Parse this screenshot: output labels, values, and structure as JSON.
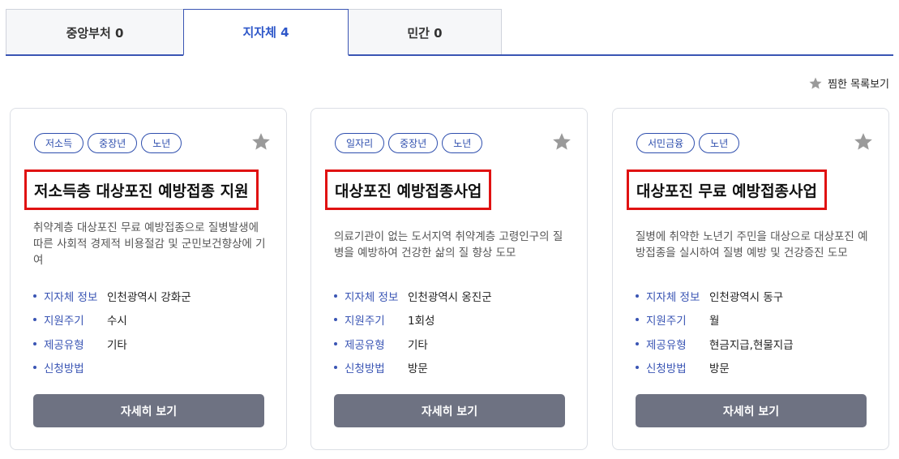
{
  "tabs": [
    {
      "label": "중앙부처 0"
    },
    {
      "label": "지자체 4"
    },
    {
      "label": "민간 0"
    }
  ],
  "favorites_link": {
    "label": "찜한 목록보기",
    "icon": "star-icon"
  },
  "colors": {
    "accent": "#2e57c9",
    "tag_border": "#2f4fae",
    "button": "#6e7282",
    "highlight": "#e01212",
    "star": "#9a9a9a"
  },
  "cards": [
    {
      "tags": [
        "저소득",
        "중장년",
        "노년"
      ],
      "title": "저소득층 대상포진 예방접종 지원",
      "desc": "취약계층 대상포진 무료 예방접종으로 질병발생에 따른 사회적 경제적 비용절감 및 군민보건향상에 기여",
      "info": [
        {
          "key": "지자체 정보",
          "value": "인천광역시 강화군"
        },
        {
          "key": "지원주기",
          "value": "수시"
        },
        {
          "key": "제공유형",
          "value": "기타"
        },
        {
          "key": "신청방법",
          "value": ""
        }
      ],
      "button": "자세히 보기"
    },
    {
      "tags": [
        "일자리",
        "중장년",
        "노년"
      ],
      "title": "대상포진 예방접종사업",
      "desc": "의료기관이 없는 도서지역 취약계층 고령인구의 질병을 예방하여 건강한 삶의 질 향상 도모",
      "info": [
        {
          "key": "지자체 정보",
          "value": "인천광역시 옹진군"
        },
        {
          "key": "지원주기",
          "value": "1회성"
        },
        {
          "key": "제공유형",
          "value": "기타"
        },
        {
          "key": "신청방법",
          "value": "방문"
        }
      ],
      "button": "자세히 보기"
    },
    {
      "tags": [
        "서민금융",
        "노년"
      ],
      "title": "대상포진 무료 예방접종사업",
      "desc": "질병에 취약한 노년기 주민을 대상으로 대상포진 예방접종을 실시하여 질병 예방 및 건강증진 도모",
      "info": [
        {
          "key": "지자체 정보",
          "value": "인천광역시 동구"
        },
        {
          "key": "지원주기",
          "value": "월"
        },
        {
          "key": "제공유형",
          "value": "현금지급,현물지급"
        },
        {
          "key": "신청방법",
          "value": "방문"
        }
      ],
      "button": "자세히 보기"
    }
  ]
}
